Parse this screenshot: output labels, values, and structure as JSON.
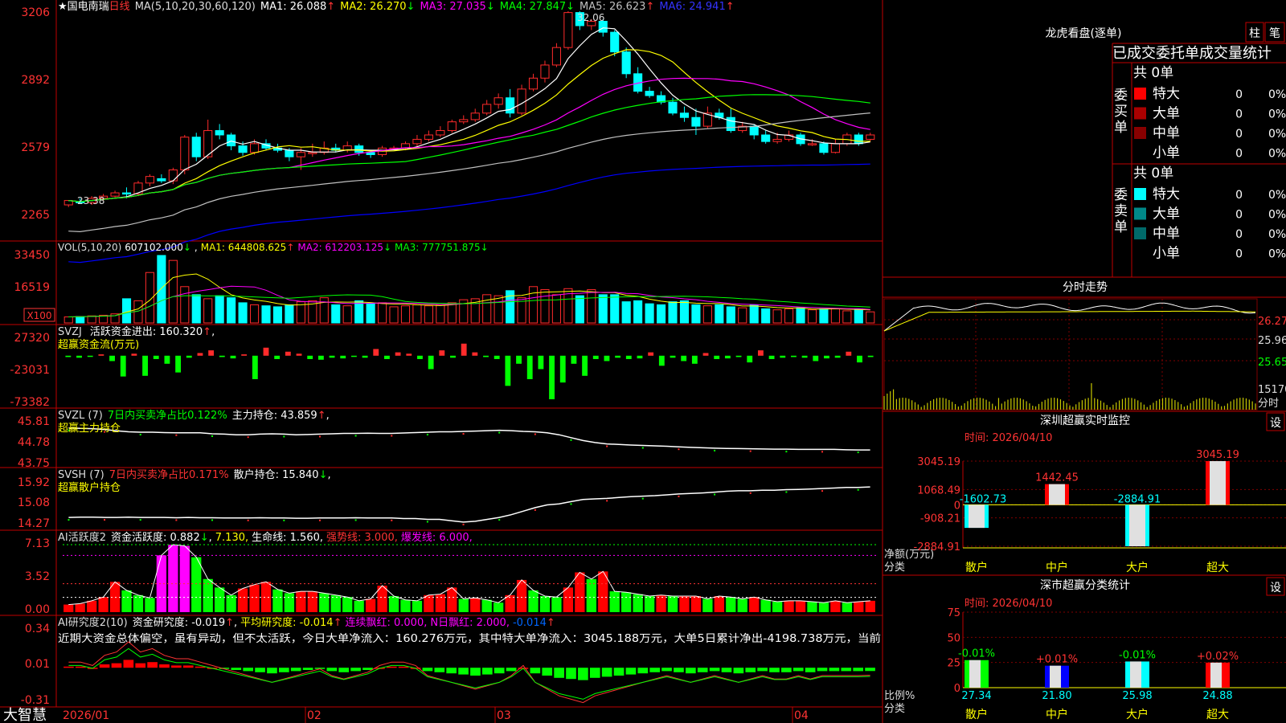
{
  "colors": {
    "up": "#ff2b2b",
    "down": "#00ffff",
    "ma1": "#ffffff",
    "ma2": "#ffff00",
    "ma3": "#ff00ff",
    "ma4": "#00ff00",
    "ma5": "#c0c0c0",
    "ma6": "#0000ff",
    "grid": "#c00000",
    "axis": "#ff3333"
  },
  "header": {
    "star": "★",
    "stock_name": "国电南瑞",
    "period": "日线",
    "ma_label": "MA(5,10,20,30,60,120)",
    "ma1": "MA1: 26.088",
    "ma1_arrow": "↑",
    "ma2": "MA2: 26.270",
    "ma2_arrow": "↓",
    "ma3": "MA3: 27.035",
    "ma3_arrow": "↓",
    "ma4": "MA4: 27.847",
    "ma4_arrow": "↓",
    "ma5": "MA5: 26.623",
    "ma5_arrow": "↑",
    "ma6": "MA6: 24.941",
    "ma6_arrow": "↑"
  },
  "price_axis": {
    "ticks": [
      "3206",
      "2892",
      "2579",
      "2265"
    ],
    "high_label": "32.06",
    "low_label": "23.38"
  },
  "vol": {
    "title": "VOL(5,10,20)",
    "value": "607102.000",
    "arrow1": "↓",
    "ma1": "MA1: 644808.625",
    "ma1_arrow": "↑",
    "ma2": "MA2: 612203.125",
    "ma2_arrow": "↓",
    "ma3": "MA3: 777751.875",
    "ma3_arrow": "↓",
    "ticks": [
      "33450",
      "16519"
    ],
    "unit": "X100"
  },
  "svzj": {
    "title": "SVZJ",
    "label": "活跃资金进出: 160.320",
    "arrow": "↑",
    "comma": ",",
    "sub": "超赢资金流(万元)",
    "ticks": [
      "27320",
      "-23031",
      "-73382"
    ]
  },
  "svzl": {
    "title": "SVZL (7)",
    "label": "7日内买卖净占比0.122%",
    "label2": "主力持仓: 43.859",
    "arrow": "↑",
    "comma": ",",
    "sub": "超赢主力持仓",
    "ticks": [
      "45.81",
      "44.78",
      "43.75"
    ]
  },
  "svsh": {
    "title": "SVSH (7)",
    "label": "7日内买卖净占比0.171%",
    "label2": "散户持仓: 15.840",
    "arrow": "↓",
    "comma": ",",
    "sub": "超赢散户持仓",
    "ticks": [
      "15.92",
      "15.08",
      "14.27"
    ]
  },
  "ai1": {
    "title": "AI活跃度2",
    "label": "资金活跃度: 0.882",
    "arrow": "↓",
    "comma": ",",
    "v2": "7.130,",
    "v3": "生命线: 1.560,",
    "v4": "强势线: 3.000,",
    "v5": "爆发线: 6.000,",
    "ticks": [
      "7.13",
      "3.52",
      "0.00"
    ]
  },
  "ai2": {
    "title": "AI研究度2(10)",
    "label": "资金研究度: -0.019",
    "arrow": "↑",
    "comma": ",",
    "v2": "平均研究度: -0.014",
    "v2_arrow": "↑",
    "v3": "连续飘红: 0.000,",
    "v4": "N日飘红: 2.000,",
    "v5": "-0.014",
    "v5_arrow": "↑",
    "desc": "近期大资金总体偏空，虽有异动，但不太活跃，今日大单净流入：160.276万元，其中特大单净流入：3045.188万元，大单5日累计净出-4198.738万元，当前",
    "ticks": [
      "0.34",
      "0.01",
      "-0.31"
    ]
  },
  "xaxis": {
    "labels": [
      "2026/01",
      "02",
      "03",
      "04"
    ]
  },
  "footer": {
    "brand": "大智慧"
  },
  "lhb": {
    "title": "龙虎看盘(逐单)",
    "btn1": "柱",
    "btn2": "笔",
    "subtitle": "已成交委托单成交量统计",
    "buy_side": "委买单",
    "sell_side": "委卖单",
    "buy_total": "共 0单",
    "sell_total": "共 0单",
    "buy_rows": [
      {
        "label": "特大",
        "val": "0",
        "pct": "0%",
        "color": "#ff0000"
      },
      {
        "label": "大单",
        "val": "0",
        "pct": "0%",
        "color": "#aa0000"
      },
      {
        "label": "中单",
        "val": "0",
        "pct": "0%",
        "color": "#880000"
      },
      {
        "label": "小单",
        "val": "0",
        "pct": "0%",
        "color": "#000000"
      }
    ],
    "sell_rows": [
      {
        "label": "特大",
        "val": "0",
        "pct": "0%",
        "color": "#00ffff"
      },
      {
        "label": "大单",
        "val": "0",
        "pct": "0%",
        "color": "#008888"
      },
      {
        "label": "中单",
        "val": "0",
        "pct": "0%",
        "color": "#006a6a"
      },
      {
        "label": "小单",
        "val": "0",
        "pct": "0%",
        "color": "#000000"
      }
    ]
  },
  "fenshi": {
    "title": "分时走势",
    "ticks": [
      "26.27",
      "25.96",
      "25.65",
      "15170"
    ],
    "unit": "分时"
  },
  "monitor": {
    "title": "深圳超赢实时监控",
    "btn": "设",
    "time": "时间: 2026/04/10",
    "axis": [
      "3045.19",
      "1068.49",
      "0",
      "-908.21",
      "-2884.91"
    ],
    "ylabel": "净额(万元)",
    "xlabel": "分类",
    "bars": [
      {
        "cat": "散户",
        "value": -1602.73,
        "label": "-1602.73"
      },
      {
        "cat": "中户",
        "value": 1442.45,
        "label": "1442.45"
      },
      {
        "cat": "大户",
        "value": -2884.91,
        "label": "-2884.91"
      },
      {
        "cat": "超大",
        "value": 3045.19,
        "label": "3045.19"
      }
    ]
  },
  "classify": {
    "title": "深市超赢分类统计",
    "btn": "设",
    "time": "时间: 2026/04/10",
    "axis": [
      "75",
      "50",
      "25",
      "0"
    ],
    "ylabel": "比例%",
    "xlabel": "分类",
    "bars": [
      {
        "cat": "散户",
        "value": 27.34,
        "change": "-0.01%",
        "val_label": "27.34"
      },
      {
        "cat": "中户",
        "value": 21.8,
        "change": "+0.01%",
        "val_label": "21.80"
      },
      {
        "cat": "大户",
        "value": 25.98,
        "change": "-0.01%",
        "val_label": "25.98"
      },
      {
        "cat": "超大",
        "value": 24.88,
        "change": "+0.02%",
        "val_label": "24.88"
      }
    ]
  },
  "chart_data": [
    {
      "type": "candlestick",
      "title": "国电南瑞 日线",
      "ylim": [
        2265,
        3206
      ],
      "candles": [
        [
          2320,
          2340,
          2310,
          2335
        ],
        [
          2335,
          2330,
          2325,
          2350
        ],
        [
          2330,
          2350,
          2320,
          2360
        ],
        [
          2350,
          2360,
          2340,
          2370
        ],
        [
          2360,
          2375,
          2350,
          2385
        ],
        [
          2375,
          2370,
          2350,
          2400
        ],
        [
          2370,
          2420,
          2360,
          2430
        ],
        [
          2420,
          2450,
          2405,
          2460
        ],
        [
          2440,
          2430,
          2420,
          2460
        ],
        [
          2430,
          2480,
          2415,
          2490
        ],
        [
          2480,
          2630,
          2460,
          2640
        ],
        [
          2630,
          2540,
          2520,
          2650
        ],
        [
          2540,
          2660,
          2530,
          2710
        ],
        [
          2660,
          2640,
          2620,
          2690
        ],
        [
          2640,
          2590,
          2570,
          2650
        ],
        [
          2590,
          2560,
          2545,
          2610
        ],
        [
          2560,
          2600,
          2550,
          2620
        ],
        [
          2600,
          2580,
          2570,
          2620
        ],
        [
          2580,
          2570,
          2560,
          2600
        ],
        [
          2570,
          2540,
          2520,
          2580
        ],
        [
          2540,
          2560,
          2480,
          2580
        ],
        [
          2560,
          2560,
          2540,
          2600
        ],
        [
          2560,
          2580,
          2550,
          2610
        ],
        [
          2580,
          2570,
          2560,
          2600
        ],
        [
          2570,
          2590,
          2560,
          2610
        ],
        [
          2590,
          2560,
          2545,
          2600
        ],
        [
          2560,
          2550,
          2535,
          2570
        ],
        [
          2550,
          2580,
          2540,
          2590
        ],
        [
          2580,
          2580,
          2570,
          2590
        ],
        [
          2580,
          2600,
          2570,
          2610
        ],
        [
          2600,
          2620,
          2585,
          2640
        ],
        [
          2620,
          2640,
          2610,
          2660
        ],
        [
          2640,
          2660,
          2630,
          2680
        ],
        [
          2660,
          2700,
          2650,
          2710
        ],
        [
          2700,
          2710,
          2690,
          2730
        ],
        [
          2710,
          2740,
          2700,
          2760
        ],
        [
          2740,
          2780,
          2730,
          2800
        ],
        [
          2780,
          2810,
          2760,
          2830
        ],
        [
          2810,
          2740,
          2720,
          2850
        ],
        [
          2740,
          2850,
          2730,
          2870
        ],
        [
          2850,
          2900,
          2840,
          2920
        ],
        [
          2900,
          2960,
          2880,
          2980
        ],
        [
          2960,
          3040,
          2950,
          3060
        ],
        [
          3040,
          3200,
          3030,
          3206
        ],
        [
          3200,
          3140,
          3120,
          3206
        ],
        [
          3140,
          3160,
          3120,
          3170
        ],
        [
          3160,
          3110,
          3090,
          3170
        ],
        [
          3110,
          3020,
          3000,
          3120
        ],
        [
          3020,
          2920,
          2900,
          3040
        ],
        [
          2920,
          2840,
          2830,
          2950
        ],
        [
          2840,
          2820,
          2810,
          2860
        ],
        [
          2820,
          2790,
          2780,
          2840
        ],
        [
          2790,
          2740,
          2730,
          2810
        ],
        [
          2740,
          2720,
          2700,
          2770
        ],
        [
          2720,
          2680,
          2640,
          2760
        ],
        [
          2680,
          2740,
          2670,
          2770
        ],
        [
          2740,
          2720,
          2710,
          2760
        ],
        [
          2720,
          2660,
          2650,
          2760
        ],
        [
          2660,
          2680,
          2650,
          2700
        ],
        [
          2680,
          2640,
          2620,
          2690
        ],
        [
          2640,
          2610,
          2600,
          2660
        ],
        [
          2610,
          2620,
          2600,
          2650
        ],
        [
          2620,
          2640,
          2610,
          2660
        ],
        [
          2640,
          2600,
          2590,
          2650
        ],
        [
          2600,
          2600,
          2590,
          2620
        ],
        [
          2600,
          2560,
          2550,
          2610
        ],
        [
          2560,
          2600,
          2555,
          2620
        ],
        [
          2600,
          2640,
          2590,
          2650
        ],
        [
          2640,
          2600,
          2590,
          2650
        ],
        [
          2620,
          2640,
          2610,
          2650
        ]
      ],
      "note": "each candle [open,close,low,high] in price units x100"
    },
    {
      "type": "bar",
      "title": "VOL(5,10,20)",
      "ylim": [
        0,
        33450
      ],
      "values": [
        3000,
        3200,
        3500,
        3800,
        4500,
        12000,
        11000,
        25000,
        33450,
        31000,
        18000,
        14000,
        12000,
        13500,
        12500,
        10000,
        9000,
        8500,
        8000,
        9000,
        10500,
        11000,
        12500,
        9000,
        8500,
        11000,
        9500,
        10000,
        8000,
        8500,
        9000,
        8500,
        9000,
        10000,
        11500,
        12000,
        14000,
        13500,
        16000,
        12500,
        18000,
        16500,
        14000,
        17000,
        13500,
        16500,
        14000,
        14000,
        10500,
        11000,
        9500,
        9000,
        10500,
        11000,
        9000,
        8500,
        9000,
        8000,
        7500,
        9000,
        7000,
        6500,
        7000,
        7500,
        6500,
        7000,
        7000,
        6000,
        7000,
        5500
      ],
      "colors": "up/down per candle"
    },
    {
      "type": "bar",
      "title": "超赢资金流(万元)",
      "ylim": [
        -73382,
        27320
      ],
      "values": [
        -2000,
        -3000,
        -1000,
        2000,
        -8000,
        -31000,
        3000,
        -30000,
        -5000,
        -12000,
        -25000,
        -3000,
        4000,
        8000,
        -2000,
        -4000,
        2000,
        -35000,
        12000,
        -5000,
        6000,
        3000,
        -5000,
        -6000,
        -3000,
        -4000,
        -1000,
        -3000,
        10000,
        -5000,
        5000,
        3000,
        -5000,
        -20000,
        8000,
        -3000,
        18000,
        5000,
        -2000,
        -5000,
        -45000,
        -12000,
        -35000,
        -20000,
        -65000,
        -40000,
        -12000,
        -30000,
        -5000,
        -8000,
        -3000,
        -5000,
        -4000,
        5000,
        -15000,
        -3000,
        -8000,
        -12000,
        4000,
        -5000,
        -4000,
        -2000,
        -10000,
        8000,
        -5000,
        -3000,
        -2000,
        -3000,
        -8000,
        -4000,
        -3000,
        6000,
        -10000,
        -2000
      ],
      "line_value": 160.32
    },
    {
      "type": "line",
      "title": "超赢主力持仓",
      "ylim": [
        43.75,
        45.81
      ],
      "values": [
        45.7,
        45.68,
        45.66,
        45.62,
        45.55,
        45.5,
        45.48,
        45.48,
        45.46,
        45.45,
        45.45,
        45.45,
        45.4,
        45.38,
        45.35,
        45.35,
        45.38,
        45.4,
        45.38,
        45.35,
        45.36,
        45.38,
        45.4,
        45.42,
        45.42,
        45.43,
        45.42,
        45.42,
        45.44,
        45.46,
        45.48,
        45.5,
        45.5,
        45.52,
        45.54,
        45.56,
        45.58,
        45.56,
        45.52,
        45.5,
        45.45,
        45.35,
        45.2,
        45.05,
        44.95,
        44.88,
        44.85,
        44.82,
        44.8,
        44.78,
        44.76,
        44.73,
        44.7,
        44.68,
        44.66,
        44.65,
        44.64,
        44.63,
        44.62,
        44.61,
        44.61,
        44.6,
        44.6,
        44.6,
        44.6,
        44.58,
        44.57,
        44.57
      ],
      "current": 43.859
    },
    {
      "type": "line",
      "title": "超赢散户持仓",
      "ylim": [
        14.27,
        15.92
      ],
      "values": [
        14.62,
        14.63,
        14.63,
        14.62,
        14.62,
        14.63,
        14.62,
        14.62,
        14.62,
        14.61,
        14.62,
        14.61,
        14.61,
        14.6,
        14.6,
        14.6,
        14.61,
        14.6,
        14.6,
        14.59,
        14.59,
        14.6,
        14.6,
        14.6,
        14.61,
        14.6,
        14.6,
        14.6,
        14.58,
        14.58,
        14.55,
        14.55,
        14.5,
        14.45,
        14.48,
        14.55,
        14.62,
        14.72,
        14.85,
        14.98,
        15.08,
        15.12,
        15.2,
        15.28,
        15.3,
        15.32,
        15.35,
        15.38,
        15.4,
        15.42,
        15.45,
        15.48,
        15.5,
        15.52,
        15.55,
        15.58,
        15.6,
        15.6,
        15.62,
        15.62,
        15.64,
        15.65,
        15.66,
        15.68,
        15.7,
        15.72,
        15.72,
        15.74
      ],
      "current": 15.84
    },
    {
      "type": "bar",
      "title": "AI活跃度2",
      "ylim": [
        0,
        7.13
      ],
      "values": [
        0.8,
        0.9,
        1.2,
        1.6,
        3.2,
        2.3,
        1.8,
        1.5,
        6.0,
        7.13,
        7.0,
        5.8,
        3.5,
        2.6,
        1.8,
        2.5,
        2.9,
        3.2,
        2.4,
        2.0,
        2.2,
        2.2,
        2.0,
        1.8,
        1.6,
        1.2,
        1.4,
        2.8,
        1.7,
        1.3,
        1.2,
        1.8,
        1.9,
        2.6,
        1.4,
        1.5,
        1.3,
        1.0,
        1.8,
        3.4,
        2.3,
        1.7,
        1.6,
        2.6,
        4.2,
        3.5,
        4.3,
        2.2,
        2.1,
        1.9,
        1.7,
        1.8,
        1.7,
        1.7,
        1.7,
        1.4,
        1.7,
        1.6,
        1.4,
        1.6,
        1.3,
        1.1,
        1.2,
        1.2,
        1.1,
        1.0,
        1.2,
        1.0,
        1.1,
        1.2
      ],
      "thresholds": [
        1.56,
        3.0,
        6.0
      ]
    },
    {
      "type": "bar",
      "title": "AI研究度2(10)",
      "ylim": [
        -0.31,
        0.34
      ],
      "values": [
        0.02,
        0.02,
        0.01,
        0.04,
        0.05,
        0.08,
        0.05,
        0.06,
        0.04,
        0.03,
        0.03,
        0.02,
        0.01,
        0.0,
        -0.01,
        -0.02,
        -0.03,
        -0.04,
        -0.03,
        -0.02,
        -0.01,
        0.0,
        -0.02,
        -0.03,
        -0.02,
        -0.01,
        0.01,
        0.02,
        0.02,
        0.01,
        -0.02,
        -0.03,
        -0.04,
        -0.05,
        -0.06,
        -0.05,
        -0.04,
        -0.02,
        0.01,
        -0.04,
        -0.06,
        -0.08,
        -0.09,
        -0.1,
        -0.08,
        -0.07,
        -0.06,
        -0.05,
        -0.04,
        -0.03,
        -0.02,
        -0.03,
        -0.04,
        -0.03,
        -0.02,
        -0.03,
        -0.04,
        -0.03,
        -0.02,
        -0.03,
        -0.03,
        -0.02,
        -0.03,
        -0.02,
        -0.02,
        -0.02,
        -0.02,
        -0.019
      ]
    }
  ]
}
